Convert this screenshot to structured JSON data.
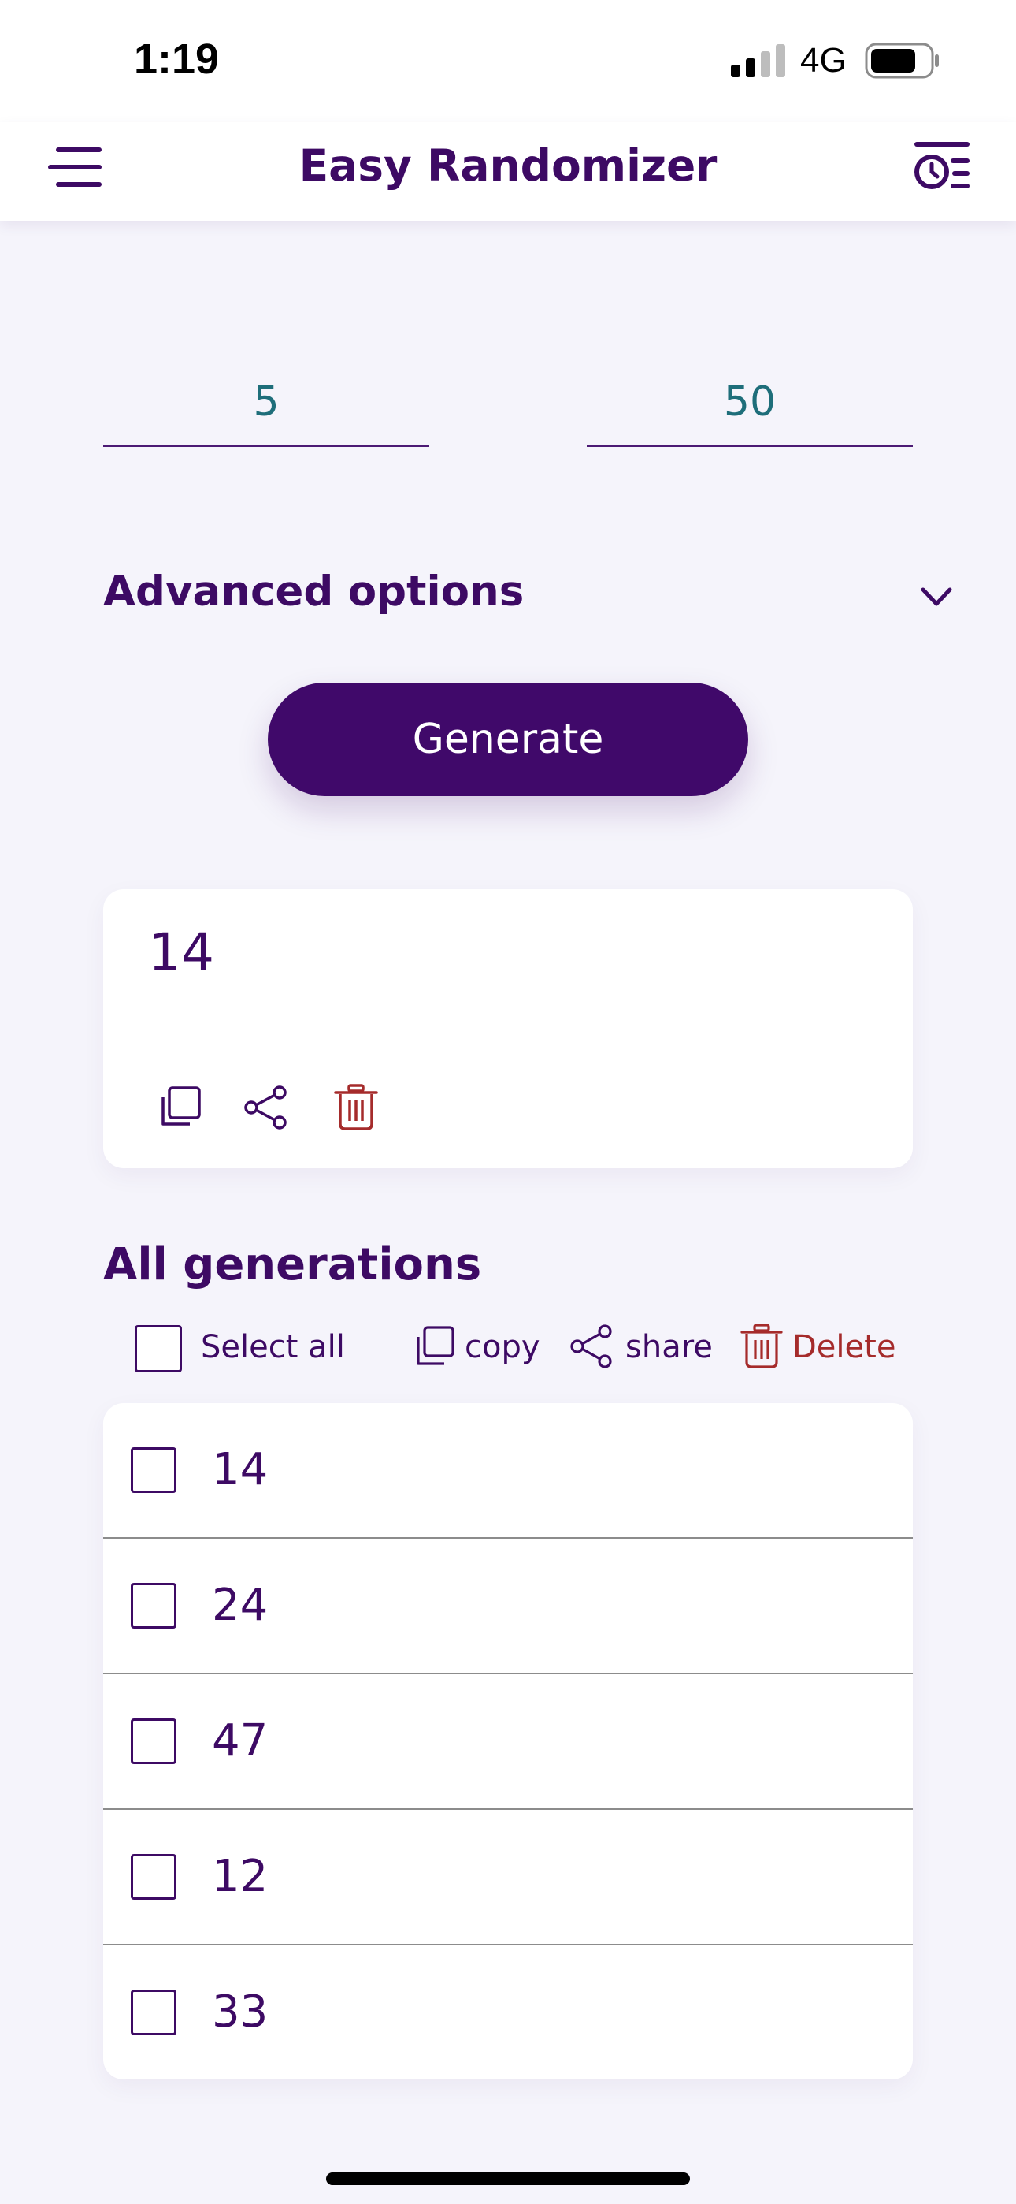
{
  "status_bar": {
    "time": "1:19",
    "network": "4G"
  },
  "header": {
    "title": "Easy Randomizer",
    "menu_icon": "hamburger-menu-icon",
    "history_icon": "history-list-icon"
  },
  "range": {
    "min_value": "5",
    "max_value": "50"
  },
  "advanced_options": {
    "label": "Advanced options",
    "icon": "chevron-down-icon"
  },
  "generate": {
    "label": "Generate"
  },
  "result": {
    "value": "14",
    "icons": [
      "copy-icon",
      "share-icon",
      "trash-icon"
    ]
  },
  "all_generations": {
    "title": "All generations",
    "toolbar": {
      "select_all_label": "Select all",
      "copy_label": "copy",
      "share_label": "share",
      "delete_label": "Delete"
    },
    "items": [
      "14",
      "24",
      "47",
      "12",
      "33"
    ]
  },
  "colors": {
    "primary": "#40096A",
    "text": "#3D0A64",
    "accent_teal": "#1E6E7A",
    "danger": "#A52B2B",
    "background": "#F5F4FB"
  }
}
